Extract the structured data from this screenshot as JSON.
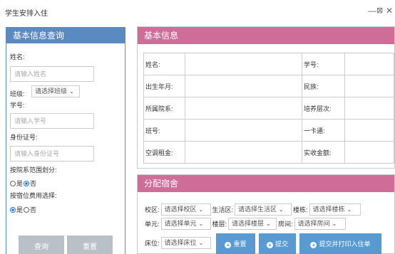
{
  "window": {
    "title": "学生安排入住",
    "min": "—",
    "max": "⊠",
    "close": "✕"
  },
  "query": {
    "title": "基本信息查询",
    "name_label": "姓名:",
    "name_placeholder": "请输入姓名",
    "class_label": "班级:",
    "class_select": "请选择班级",
    "student_no_label": "学号:",
    "student_no_placeholder": "请输入学号",
    "id_label": "身份证号:",
    "id_placeholder": "请输入身份证号",
    "by_dept_label": "按院系范围划分:",
    "by_dept_yes": "是",
    "by_dept_no": "否",
    "by_fee_label": "按宿位费用选择:",
    "by_fee_yes": "是",
    "by_fee_no": "否",
    "search_button": "查询",
    "reset_button": "重置"
  },
  "info": {
    "title": "基本信息",
    "rows": [
      {
        "l1": "姓名:",
        "v1": "",
        "l2": "学号:",
        "v2": ""
      },
      {
        "l1": "出生年月:",
        "v1": "",
        "l2": "民族:",
        "v2": ""
      },
      {
        "l1": "所属院系:",
        "v1": "",
        "l2": "培养层次:",
        "v2": ""
      },
      {
        "l1": "班号:",
        "v1": "",
        "l2": "一卡通:",
        "v2": ""
      },
      {
        "l1": "空调租金:",
        "v1": "",
        "l2": "实收金额:",
        "v2": ""
      }
    ]
  },
  "assign": {
    "title": "分配宿舍",
    "campus_label": "校区:",
    "campus_select": "请选择校区",
    "area_label": "生活区:",
    "area_select": "请选择生活区",
    "building_label": "楼栋:",
    "building_select": "请选择楼栋",
    "unit_label": "单元:",
    "unit_select": "请选择单元",
    "floor_label": "楼层:",
    "floor_select": "请选择楼层",
    "room_label": "房间:",
    "room_select": "请选择房间",
    "bed_label": "床位:",
    "bed_select": "请选择床位",
    "reset_button": "重置",
    "submit_button": "提交",
    "submit_print_button": "提交并打印入住单"
  }
}
